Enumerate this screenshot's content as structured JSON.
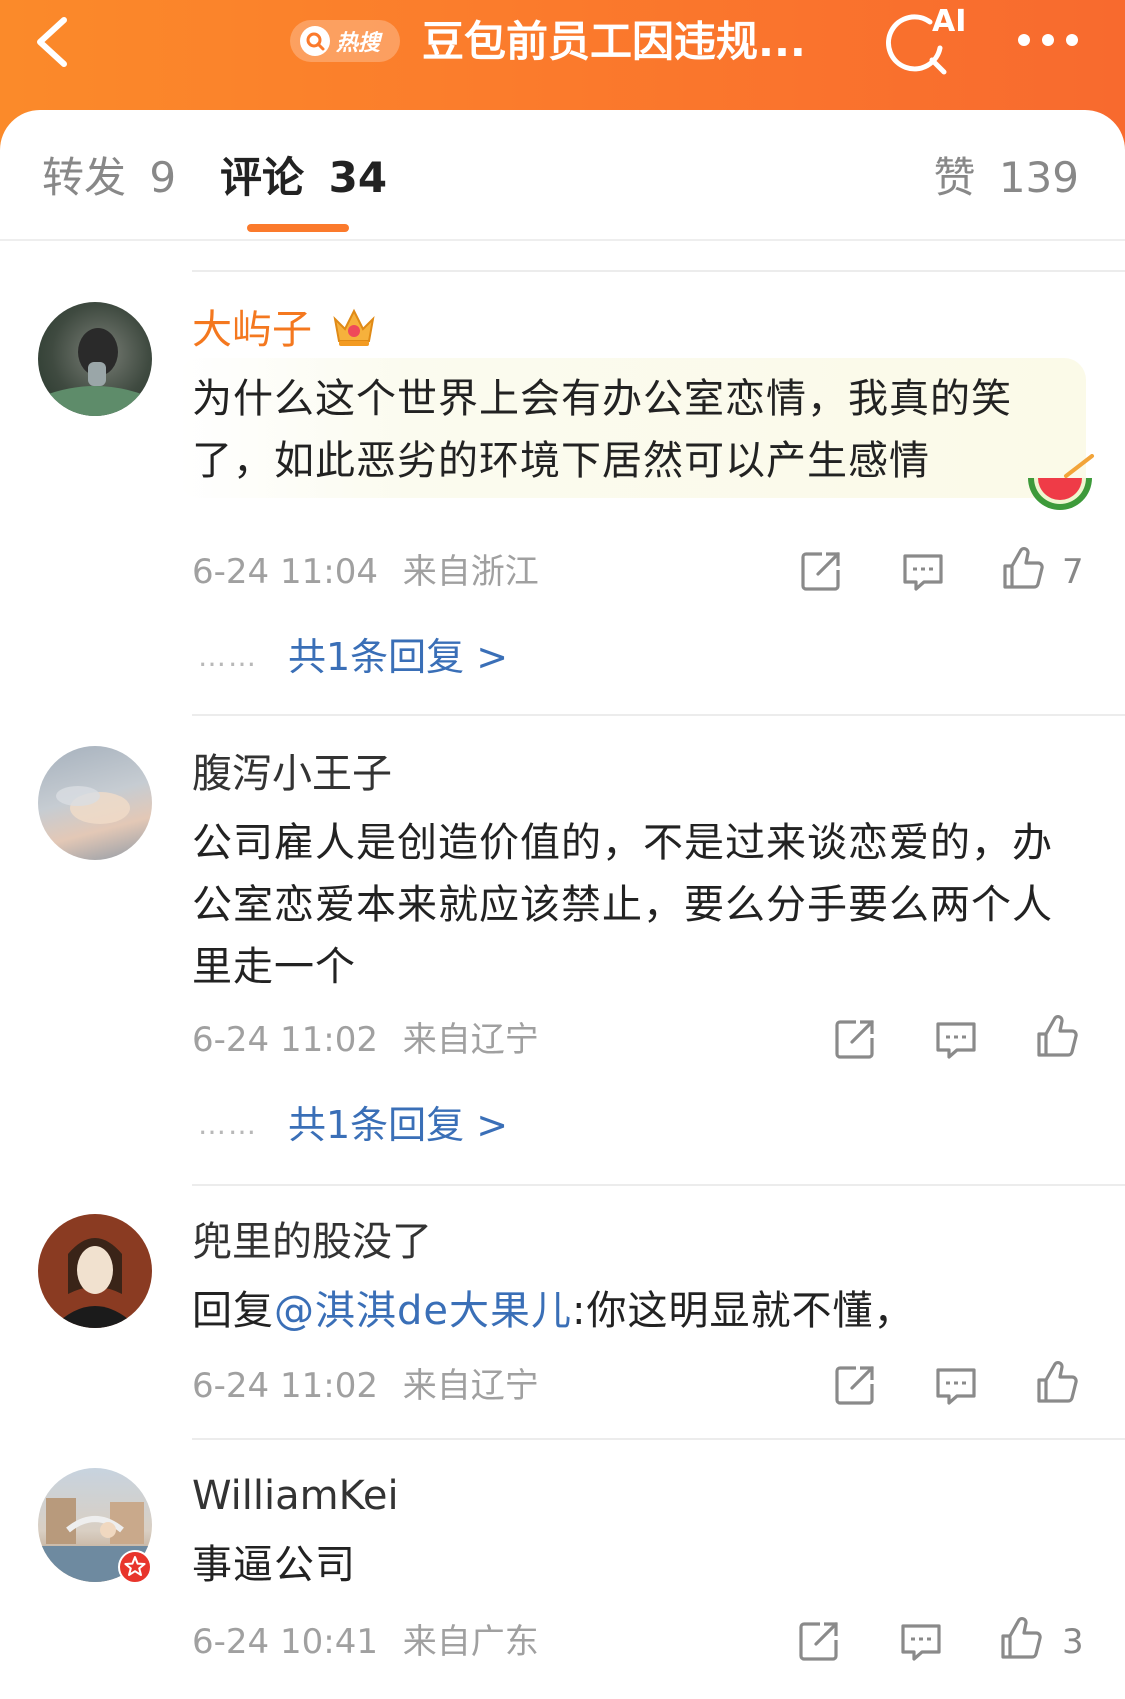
{
  "header": {
    "hot_search_label": "热搜",
    "title": "豆包前员工因违规...",
    "ai_label": "AI"
  },
  "tabs": {
    "repost_label": "转发",
    "repost_count": "9",
    "comment_label": "评论",
    "comment_count": "34",
    "like_label": "赞",
    "like_count": "139"
  },
  "comments": [
    {
      "username": "大屿子",
      "badge_icon": "crown-icon",
      "text": "为什么这个世界上会有办公室恋情，我真的笑了，如此恶劣的环境下居然可以产生感情",
      "decoration_icon": "watermelon-icon",
      "date": "6-24 11:04",
      "location": "来自浙江",
      "likes": "7",
      "reply_summary": "共1条回复 >"
    },
    {
      "username": "腹泻小王子",
      "text": "公司雇人是创造价值的，不是过来谈恋爱的，办公室恋爱本来就应该禁止，要么分手要么两个人里走一个",
      "date": "6-24 11:02",
      "location": "来自辽宁",
      "likes": "",
      "reply_summary": "共1条回复 >"
    },
    {
      "username": "兜里的股没了",
      "reply_prefix": "回复",
      "mention": "@淇淇de大果儿",
      "text": ":你这明显就不懂，",
      "date": "6-24 11:02",
      "location": "来自辽宁",
      "likes": ""
    },
    {
      "username": "WilliamKei",
      "badge_icon": "verified-badge-icon",
      "text": "事逼公司",
      "date": "6-24 10:41",
      "location": "来自广东",
      "likes": "3"
    }
  ],
  "colors": {
    "header_orange": "#fb7a2c",
    "link_blue": "#3a6fb7",
    "vip_name": "#f4781f"
  }
}
